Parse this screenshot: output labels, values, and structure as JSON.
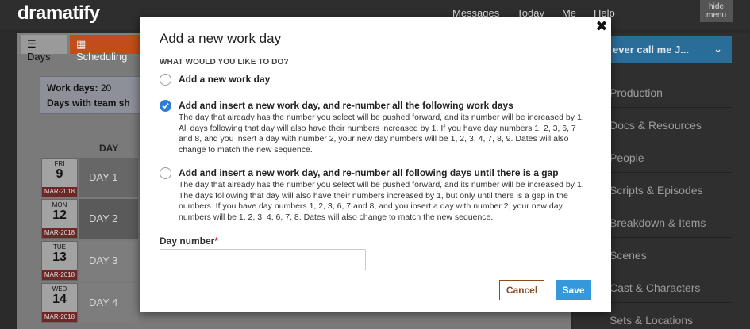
{
  "app": {
    "logo": "dramatify",
    "nav": [
      "Messages",
      "Today",
      "Me",
      "Help"
    ],
    "hide_menu": "hide menu"
  },
  "tabs": {
    "days": "Days",
    "scheduling": "Scheduling"
  },
  "info": {
    "work_days_label": "Work days:",
    "work_days_value": "20",
    "team_label": "Days with team sh"
  },
  "table": {
    "column_day": "DAY",
    "rows": [
      {
        "dow": "FRI",
        "num": "9",
        "mon": "MAR-2018",
        "day": "DAY 1"
      },
      {
        "dow": "MON",
        "num": "12",
        "mon": "MAR-2018",
        "day": "DAY 2"
      },
      {
        "dow": "TUE",
        "num": "13",
        "mon": "MAR-2018",
        "day": "DAY 3"
      },
      {
        "dow": "WED",
        "num": "14",
        "mon": "MAR-2018",
        "day": "DAY 4"
      }
    ]
  },
  "sidebar": {
    "project": "ever call me J...",
    "items": [
      "Production",
      "Docs & Resources",
      "People",
      "Scripts & Episodes",
      "Breakdown & Items",
      "Scenes",
      "Cast & Characters",
      "Sets & Locations"
    ]
  },
  "modal": {
    "title": "Add a new work day",
    "section_label": "WHAT WOULD YOU LIKE TO DO?",
    "options": [
      {
        "title": "Add a new work day",
        "desc": "",
        "checked": false
      },
      {
        "title": "Add and insert a new work day, and re-number all the following work days",
        "desc": "The day that already has the number you select will be pushed forward, and its number will be increased by 1. All days following that day will also have their numbers increased by 1. If you have day numbers 1, 2, 3, 6, 7 and 8, and you insert a day with number 2, your new day numbers will be 1, 2, 3, 4, 7, 8, 9. Dates will also change to match the new sequence.",
        "checked": true
      },
      {
        "title": "Add and insert a new work day, and re-number all following days until there is a gap",
        "desc": "The day that already has the number you select will be pushed forward, and its number will be increased by 1. The days following that day will also have their numbers increased by 1, but only until there is a gap in the numbers. If you have day numbers 1, 2, 3, 6, 7 and 8, and you insert a day with number 2, your new day numbers will be 1, 2, 3, 4, 6, 7, 8. Dates will also change to match the new sequence.",
        "checked": false
      }
    ],
    "day_number_label": "Day number",
    "required_mark": "*",
    "day_number_value": "",
    "day_number_placeholder": "",
    "cancel_label": "Cancel",
    "save_label": "Save",
    "close_symbol": "✖"
  },
  "colors": {
    "accent": "#3498db",
    "cancel": "#8a4b1f",
    "checked_radio": "#2b7dd8"
  }
}
